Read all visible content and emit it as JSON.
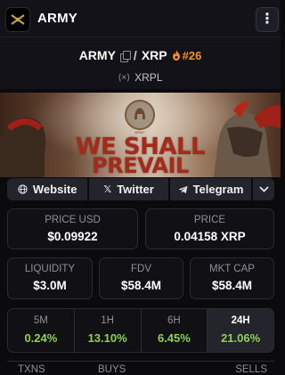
{
  "app": {
    "name": "ARMY",
    "menu_icon": "vertical-ellipsis-icon"
  },
  "pair": {
    "base": "ARMY",
    "separator": "/",
    "quote": "XRP",
    "rank": "#26",
    "chain": "XRPL",
    "chain_icon": "xrpl-icon"
  },
  "banner": {
    "line1": "WE SHALL",
    "line2": "PREVAIL",
    "emblem_label": "ARMY"
  },
  "links": [
    {
      "label": "Website",
      "icon": "globe-icon"
    },
    {
      "label": "Twitter",
      "icon": "x-icon"
    },
    {
      "label": "Telegram",
      "icon": "telegram-icon"
    }
  ],
  "stats": {
    "price_usd": {
      "label": "PRICE USD",
      "value": "$0.09922"
    },
    "price": {
      "label": "PRICE",
      "value": "0.04158 XRP"
    },
    "liquidity": {
      "label": "LIQUIDITY",
      "value": "$3.0M"
    },
    "fdv": {
      "label": "FDV",
      "value": "$58.4M"
    },
    "mkt_cap": {
      "label": "MKT CAP",
      "value": "$58.4M"
    }
  },
  "changes": [
    {
      "label": "5M",
      "value": "0.24%",
      "active": false
    },
    {
      "label": "1H",
      "value": "13.10%",
      "active": false
    },
    {
      "label": "6H",
      "value": "6.45%",
      "active": false
    },
    {
      "label": "24H",
      "value": "21.06%",
      "active": true
    }
  ],
  "txns_header": {
    "txns": "TXNS",
    "buys": "BUYS",
    "sells": "SELLS"
  },
  "colors": {
    "positive": "#8fd14f",
    "rank": "#f7931a",
    "banner_text": "#a52a1a"
  }
}
